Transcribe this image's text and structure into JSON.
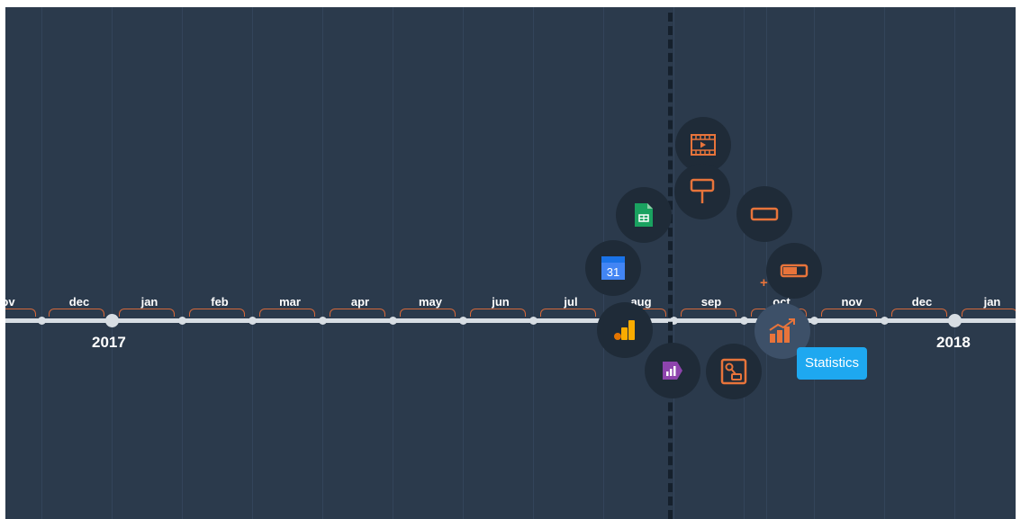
{
  "timeline": {
    "months": [
      "ov",
      "dec",
      "jan",
      "feb",
      "mar",
      "apr",
      "may",
      "jun",
      "jul",
      "aug",
      "sep",
      "oct",
      "nov",
      "dec",
      "jan"
    ],
    "years": [
      "2017",
      "2018"
    ]
  },
  "colors": {
    "background": "#2b3a4c",
    "accent": "#e8743b",
    "axis": "#d7dde3",
    "tooltip": "#1ea8f0",
    "node": "#1f2b38"
  },
  "nodes": [
    {
      "icon": "video-icon"
    },
    {
      "icon": "signpost-icon"
    },
    {
      "icon": "google-sheets-icon"
    },
    {
      "icon": "button-shape-icon"
    },
    {
      "icon": "google-calendar-icon"
    },
    {
      "icon": "toggle-switch-icon"
    },
    {
      "icon": "google-analytics-icon"
    },
    {
      "icon": "statistics-icon"
    },
    {
      "icon": "data-studio-icon"
    },
    {
      "icon": "workflow-icon"
    }
  ],
  "calendar_day": "31",
  "tooltip": {
    "text": "Statistics"
  },
  "plus_symbol": "+"
}
